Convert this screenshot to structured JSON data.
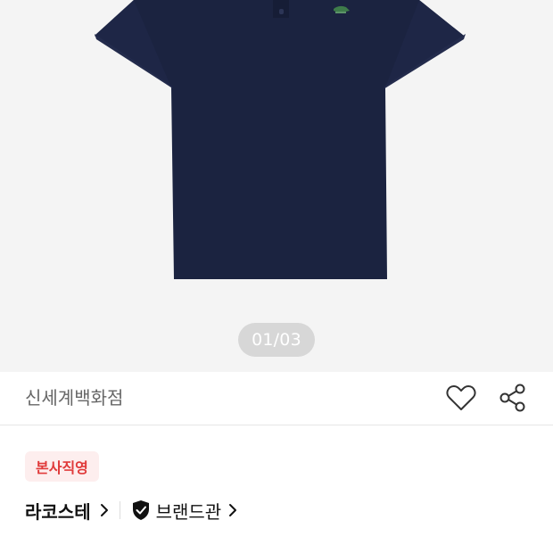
{
  "gallery": {
    "counter": "01/03"
  },
  "store": {
    "name": "신세계백화점"
  },
  "badge": {
    "label": "본사직영"
  },
  "brand": {
    "name": "라코스테",
    "hall_label": "브랜드관"
  },
  "icons": {
    "wishlist": "heart-outline-icon",
    "share": "share-icon",
    "brand_chevron": "chevron-right-icon",
    "official": "shield-check-icon"
  },
  "colors": {
    "shirt": "#1b2340",
    "hero_bg": "#f4f4f4",
    "badge_bg": "#fdeeee",
    "badge_text": "#e03a3a"
  }
}
